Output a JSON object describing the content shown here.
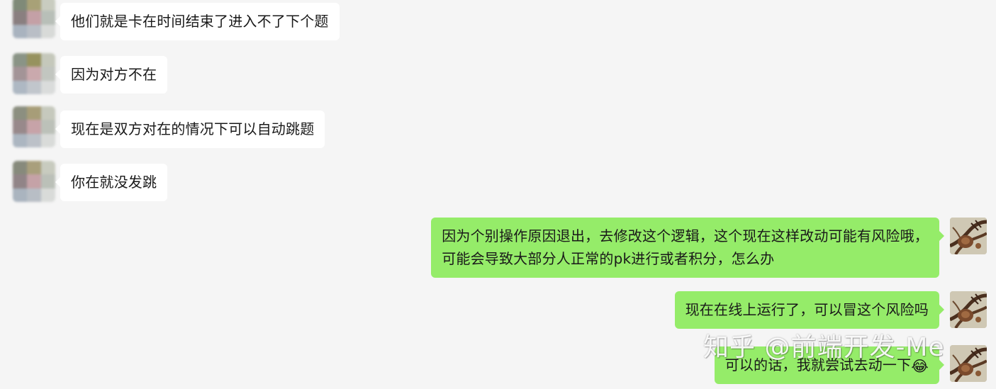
{
  "chat": {
    "incoming": [
      {
        "text": "他们就是卡在时间结束了进入不了下个题"
      },
      {
        "text": "因为对方不在"
      },
      {
        "text": "现在是双方对在的情况下可以自动跳题"
      },
      {
        "text": "你在就没发跳"
      }
    ],
    "outgoing": [
      {
        "lines": [
          "因为个别操作原因退出，去修改这个逻辑，这个现在这样改动可能有风险哦，",
          "可能会导致大部分人正常的pk进行或者积分，怎么办"
        ]
      },
      {
        "text": "现在在线上运行了，可以冒这个风险吗"
      },
      {
        "text": "可以的话，我就尝试去动一下",
        "emoji": "😂",
        "emoji_name": "tears-of-joy-emoji"
      }
    ]
  },
  "avatars": {
    "contact_icon": "blurred-contact-avatar",
    "self_icon": "user-avatar-illustration",
    "mosaic_colors": [
      [
        "#7f8a78",
        "#a8a177",
        "#c9ccc0",
        "#8a7f80",
        "#c4a0a6",
        "#b8bfb8",
        "#a9b3bf",
        "#b9bec6",
        "#d8dad8"
      ],
      [
        "#8a9486",
        "#96925e",
        "#c5c8bb",
        "#a39497",
        "#caa9ad",
        "#c2c6c0",
        "#aeb8c3",
        "#c1c6cc",
        "#dadcdb"
      ],
      [
        "#8c8f80",
        "#a79d78",
        "#c6c9bd",
        "#98898b",
        "#c7a3a8",
        "#bcc1b9",
        "#acb6c1",
        "#bcc1c8",
        "#d9dbd9"
      ],
      [
        "#878a7c",
        "#a99f7c",
        "#c8cbbf",
        "#918487",
        "#c5a2a7",
        "#bbc0b8",
        "#aab4bf",
        "#b8bec5",
        "#d9dbd9"
      ]
    ]
  },
  "watermark": {
    "text": "知乎 @前端开发-Me"
  }
}
